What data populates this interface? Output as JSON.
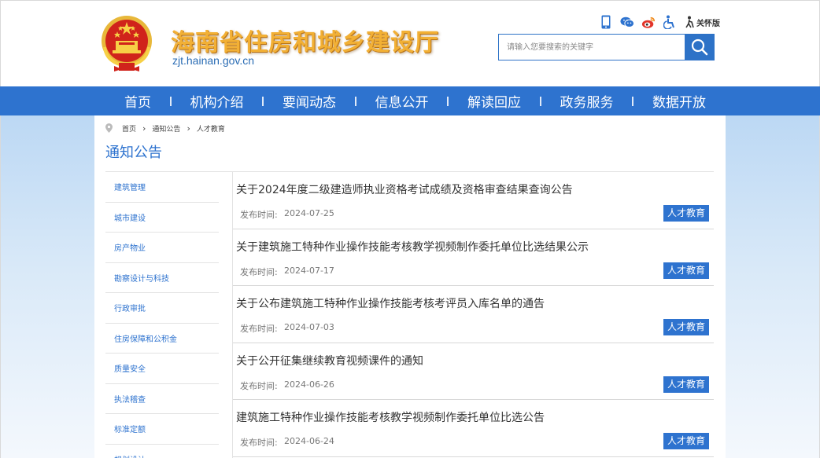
{
  "header": {
    "site_title": "海南省住房和城乡建设厅",
    "site_url": "zjt.hainan.gov.cn",
    "emblem_icon": "national-emblem-icon",
    "tools": [
      "mobile-icon",
      "wechat-icon",
      "weibo-icon",
      "accessibility-icon"
    ],
    "care_label": "关怀版",
    "search_placeholder": "请输入您要搜索的关键字"
  },
  "nav": {
    "items": [
      "首页",
      "机构介绍",
      "要闻动态",
      "信息公开",
      "解读回应",
      "政务服务",
      "数据开放"
    ]
  },
  "breadcrumb": {
    "items": [
      "首页",
      "通知公告",
      "人才教育"
    ]
  },
  "section_title": "通知公告",
  "sidebar": {
    "items": [
      "建筑管理",
      "城市建设",
      "房产物业",
      "勘察设计与科技",
      "行政审批",
      "住房保障和公积金",
      "质量安全",
      "执法稽查",
      "标准定额",
      "规划设计"
    ]
  },
  "list": {
    "date_label": "发布时间:",
    "items": [
      {
        "title": "关于2024年度二级建造师执业资格考试成绩及资格审查结果查询公告",
        "date": "2024-07-25",
        "tag": "人才教育"
      },
      {
        "title": "关于建筑施工特种作业操作技能考核教学视频制作委托单位比选结果公示",
        "date": "2024-07-17",
        "tag": "人才教育"
      },
      {
        "title": "关于公布建筑施工特种作业操作技能考核考评员入库名单的通告",
        "date": "2024-07-03",
        "tag": "人才教育"
      },
      {
        "title": "关于公开征集继续教育视频课件的通知",
        "date": "2024-06-26",
        "tag": "人才教育"
      },
      {
        "title": "建筑施工特种作业操作技能考核教学视频制作委托单位比选公告",
        "date": "2024-06-24",
        "tag": "人才教育"
      }
    ]
  },
  "colors": {
    "primary": "#2e73cf",
    "title_gold": "#f2b035",
    "text": "#333333"
  }
}
